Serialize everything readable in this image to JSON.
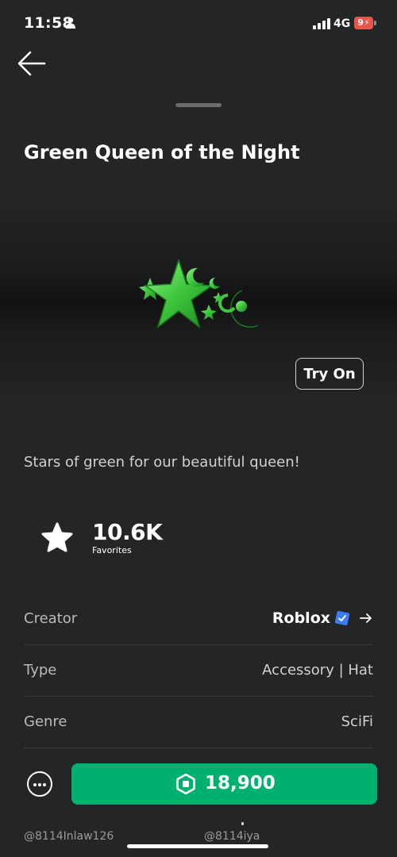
{
  "status_bar": {
    "time": "11:58",
    "network": "4G",
    "battery": "9",
    "battery_color": "#e8564a"
  },
  "item": {
    "title": "Green Queen of the Night",
    "description": "Stars of green for our beautiful queen!",
    "try_on_label": "Try On",
    "image_icon": "green-star-moon-crown"
  },
  "stats": {
    "favorites_count": "10.6K",
    "favorites_label": "Favorites"
  },
  "details": [
    {
      "label": "Creator",
      "value": "Roblox",
      "verified": true
    },
    {
      "label": "Type",
      "value": "Accessory | Hat"
    },
    {
      "label": "Genre",
      "value": "SciFi"
    }
  ],
  "purchase": {
    "price": "18,900",
    "currency_icon": "robux-icon",
    "accent_color": "#00b06f"
  },
  "watermarks": [
    "@8114Inlaw126",
    "@8114iya"
  ]
}
